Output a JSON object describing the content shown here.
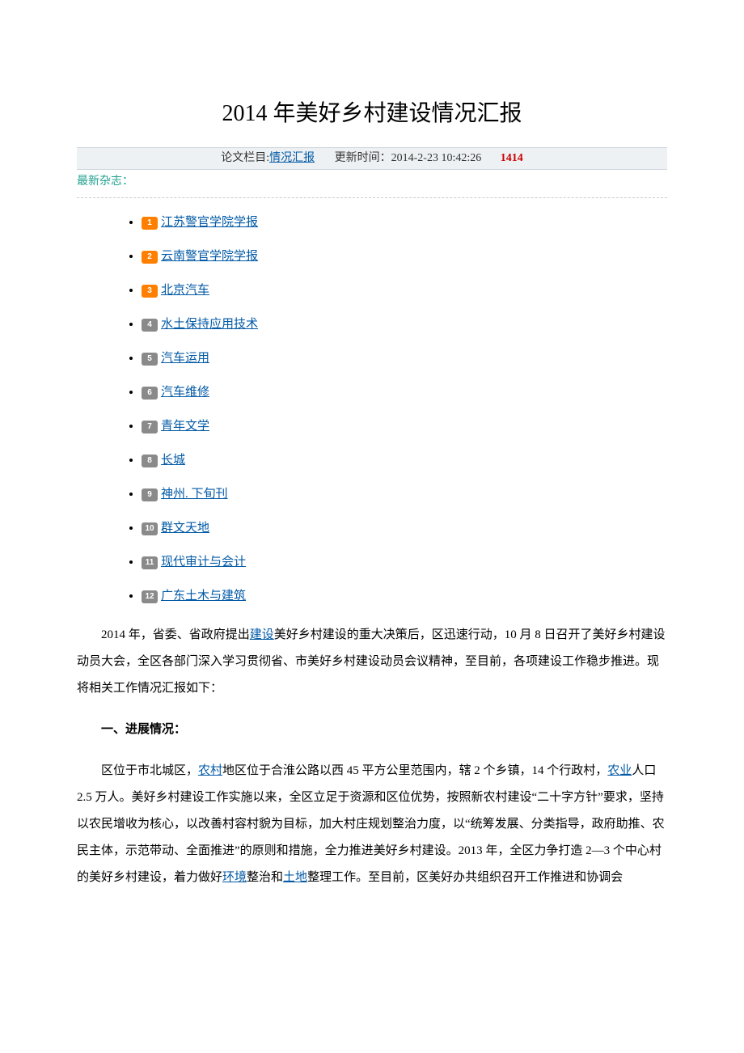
{
  "title": "2014 年美好乡村建设情况汇报",
  "meta": {
    "column_label": "论文栏目:",
    "column_link": "情况汇报",
    "update_label": "更新时间：",
    "update_time": "2014-2-23 10:42:26",
    "count": "1414"
  },
  "latest_label": "最新杂志：",
  "magazines": [
    {
      "n": "1",
      "name": "江苏警官学院学报",
      "hot": true
    },
    {
      "n": "2",
      "name": "云南警官学院学报",
      "hot": true
    },
    {
      "n": "3",
      "name": "北京汽车",
      "hot": true
    },
    {
      "n": "4",
      "name": "水土保持应用技术",
      "hot": false
    },
    {
      "n": "5",
      "name": "汽车运用",
      "hot": false
    },
    {
      "n": "6",
      "name": "汽车维修",
      "hot": false
    },
    {
      "n": "7",
      "name": "青年文学",
      "hot": false
    },
    {
      "n": "8",
      "name": "长城",
      "hot": false
    },
    {
      "n": "9",
      "name": "神州. 下旬刊",
      "hot": false
    },
    {
      "n": "10",
      "name": "群文天地",
      "hot": false
    },
    {
      "n": "11",
      "name": "现代审计与会计",
      "hot": false
    },
    {
      "n": "12",
      "name": "广东土木与建筑",
      "hot": false
    }
  ],
  "body": {
    "p1_a": "2014 年，省委、省政府提出",
    "p1_link1": "建设",
    "p1_b": "美好乡村建设的重大决策后，区迅速行动，10 月 8 日召开了美好乡村建设动员大会，全区各部门深入学习贯彻省、市美好乡村建设动员会议精神，至目前，各项建设工作稳步推进。现将相关工作情况汇报如下：",
    "h1": "一、进展情况：",
    "p2_a": "区位于市北城区，",
    "p2_link1": "农村",
    "p2_b": "地区位于合淮公路以西 45 平方公里范围内，辖 2 个乡镇，14 个行政村，",
    "p2_link2": "农业",
    "p2_c": "人口 2.5 万人。美好乡村建设工作实施以来，全区立足于资源和区位优势，按照新农村建设“二十字方针”要求，坚持以农民增收为核心，以改善村容村貌为目标，加大村庄规划整治力度，以“统筹发展、分类指导，政府助推、农民主体，示范带动、全面推进”的原则和措施，全力推进美好乡村建设。2013 年，全区力争打造 2—3 个中心村的美好乡村建设，着力做好",
    "p2_link3": "环境",
    "p2_d": "整治和",
    "p2_link4": "土地",
    "p2_e": "整理工作。至目前，区美好办共组织召开工作推进和协调会"
  }
}
